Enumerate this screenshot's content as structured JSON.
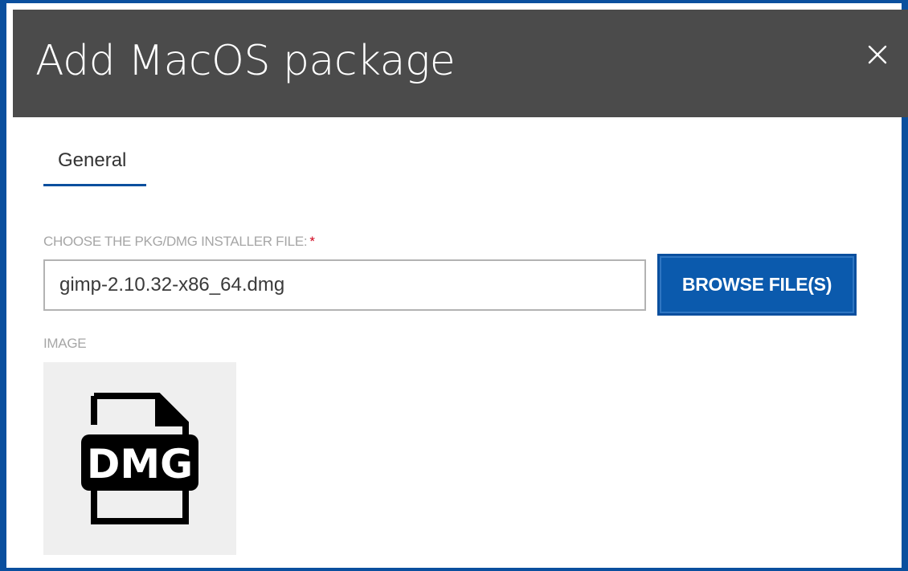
{
  "dialog": {
    "title": "Add MacOS package",
    "close_icon": "close-icon"
  },
  "tabs": [
    {
      "label": "General",
      "active": true
    }
  ],
  "form": {
    "installer_label": "CHOOSE THE PKG/DMG INSTALLER FILE:",
    "required_mark": "*",
    "installer_value": "gimp-2.10.32-x86_64.dmg",
    "browse_label": "BROWSE FILE(S)",
    "image_label": "IMAGE",
    "image_icon": "dmg-file-icon",
    "image_icon_text": "DMG"
  },
  "colors": {
    "accent": "#0a4f9e",
    "titlebar": "#4b4b4b",
    "button": "#0b5aad",
    "label": "#a6a6a6",
    "required": "#d0021b",
    "image_bg": "#efefef"
  }
}
